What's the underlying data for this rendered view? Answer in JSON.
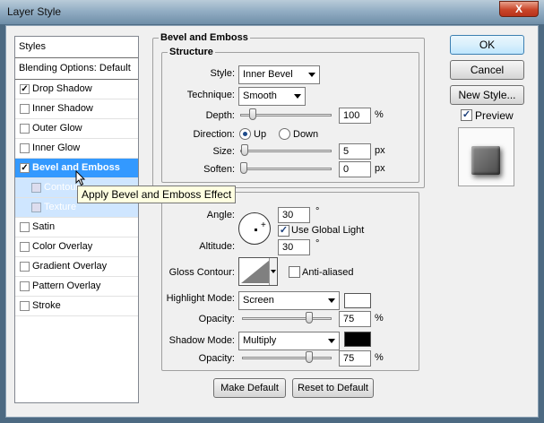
{
  "window": {
    "title": "Layer Style",
    "close_label": "X"
  },
  "styles_list": {
    "header": "Styles",
    "items": [
      {
        "label": "Blending Options: Default",
        "type": "header"
      },
      {
        "label": "Drop Shadow",
        "checked": true
      },
      {
        "label": "Inner Shadow",
        "checked": false
      },
      {
        "label": "Outer Glow",
        "checked": false
      },
      {
        "label": "Inner Glow",
        "checked": false
      },
      {
        "label": "Bevel and Emboss",
        "checked": true,
        "selected": true
      },
      {
        "label": "Contour",
        "checked": false,
        "sub": true
      },
      {
        "label": "Texture",
        "checked": false,
        "sub": true
      },
      {
        "label": "Satin",
        "checked": false
      },
      {
        "label": "Color Overlay",
        "checked": false
      },
      {
        "label": "Gradient Overlay",
        "checked": false
      },
      {
        "label": "Pattern Overlay",
        "checked": false
      },
      {
        "label": "Stroke",
        "checked": false
      }
    ]
  },
  "tooltip": "Apply Bevel and Emboss Effect",
  "bevel": {
    "section_title": "Bevel and Emboss",
    "structure_title": "Structure",
    "style_label": "Style:",
    "style_value": "Inner Bevel",
    "technique_label": "Technique:",
    "technique_value": "Smooth",
    "depth_label": "Depth:",
    "depth_value": "100",
    "depth_unit": "%",
    "direction_label": "Direction:",
    "direction_up": "Up",
    "direction_down": "Down",
    "size_label": "Size:",
    "size_value": "5",
    "size_unit": "px",
    "soften_label": "Soften:",
    "soften_value": "0",
    "soften_unit": "px"
  },
  "shading": {
    "angle_label": "Angle:",
    "angle_value": "30",
    "angle_unit": "°",
    "global_light_label": "Use Global Light",
    "altitude_label": "Altitude:",
    "altitude_value": "30",
    "altitude_unit": "°",
    "gloss_label": "Gloss Contour:",
    "anti_aliased_label": "Anti-aliased",
    "highlight_mode_label": "Highlight Mode:",
    "highlight_mode_value": "Screen",
    "highlight_color": "#ffffff",
    "highlight_opacity_label": "Opacity:",
    "highlight_opacity_value": "75",
    "shadow_mode_label": "Shadow Mode:",
    "shadow_mode_value": "Multiply",
    "shadow_color": "#000000",
    "shadow_opacity_label": "Opacity:",
    "shadow_opacity_value": "75",
    "percent": "%"
  },
  "buttons": {
    "make_default": "Make Default",
    "reset_default": "Reset to Default",
    "ok": "OK",
    "cancel": "Cancel",
    "new_style": "New Style...",
    "preview_label": "Preview"
  }
}
